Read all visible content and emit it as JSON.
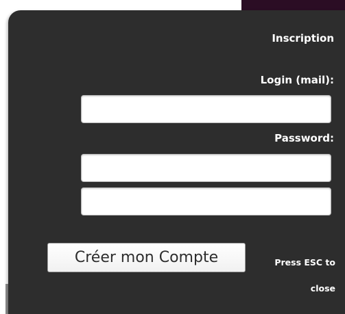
{
  "form": {
    "title": "Inscription",
    "login_label": "Login (mail):",
    "login_value": "",
    "password_label": "Password:",
    "password_value": "",
    "password_confirm_value": "",
    "submit_label": "Créer mon Compte",
    "esc_hint": "Press ESC to close"
  },
  "colors": {
    "panel_background": "#2d2d2d",
    "label_text": "#ffffff",
    "input_background": "#ffffff",
    "button_text": "#2d2d2d",
    "top_strip": "#2b0d24"
  }
}
